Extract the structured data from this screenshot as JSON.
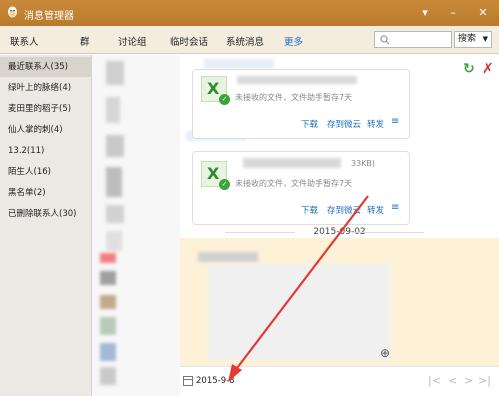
{
  "window": {
    "title": "消息管理器",
    "controls": [
      "▾",
      "–",
      "✕"
    ]
  },
  "nav": {
    "items": [
      {
        "label": "联系人",
        "active": false
      },
      {
        "label": "群",
        "active": false
      },
      {
        "label": "讨论组",
        "active": false
      },
      {
        "label": "临时会话",
        "active": false
      },
      {
        "label": "系统消息",
        "active": false
      },
      {
        "label": "更多",
        "active": true
      }
    ],
    "search_placeholder": "",
    "search_button": "搜索"
  },
  "sidebar": {
    "groups": [
      {
        "label": "最近联系人(35)",
        "selected": true
      },
      {
        "label": "绿叶上的脉络(4)"
      },
      {
        "label": "麦田里的稻子(5)"
      },
      {
        "label": "仙人掌的刺(4)"
      },
      {
        "label": "13.2(11)"
      },
      {
        "label": "陌生人(16)"
      },
      {
        "label": "黑名单(2)"
      },
      {
        "label": "已删除联系人(30)"
      }
    ]
  },
  "messages": {
    "cards": [
      {
        "file_size_hint": "",
        "note": "未接收的文件，文件助手暂存7天",
        "actions": [
          "下载",
          "存到微云",
          "转发"
        ]
      },
      {
        "file_size_hint": "33KB)",
        "note": "未接收的文件，文件助手暂存7天",
        "actions": [
          "下载",
          "存到微云",
          "转发"
        ]
      }
    ],
    "date_separator": "2015-09-02"
  },
  "bottom": {
    "date": "2015-9-8",
    "pager": [
      "|<",
      "<",
      ">",
      ">|"
    ]
  },
  "colors": {
    "titlebar": "#c98a3c",
    "accent": "#1a6fc4",
    "highlight": "#fdf2d7",
    "annotation_arrow": "#e53935"
  }
}
